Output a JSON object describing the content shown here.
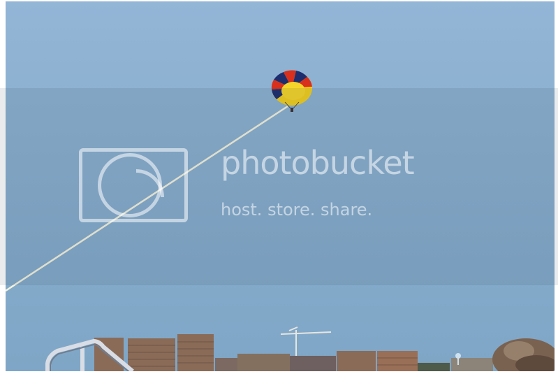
{
  "watermark": {
    "title": "photobucket",
    "subtitle": "host. store. share."
  },
  "colors": {
    "sky_top": "#8fb3d6",
    "sky_bottom": "#7ea7c9",
    "canopy_yellow": "#f3cf1e",
    "canopy_red": "#d8301c",
    "canopy_navy": "#1e2d6e",
    "tow_line": "#f2f0d6",
    "buildings": "#8a6b58"
  }
}
